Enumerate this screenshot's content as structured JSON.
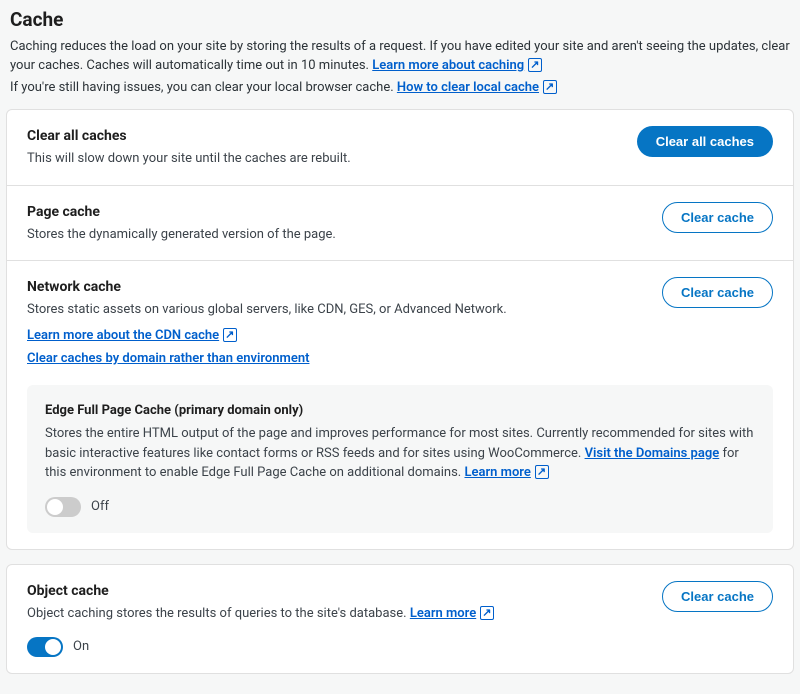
{
  "header": {
    "title": "Cache",
    "desc1": "Caching reduces the load on your site by storing the results of a request. If you have edited your site and aren't seeing the updates, clear your caches. Caches will automatically time out in 10 minutes.",
    "link1": "Learn more about caching",
    "desc2": "If you're still having issues, you can clear your local browser cache.",
    "link2": "How to clear local cache"
  },
  "clearAll": {
    "title": "Clear all caches",
    "desc": "This will slow down your site until the caches are rebuilt.",
    "button": "Clear all caches"
  },
  "pageCache": {
    "title": "Page cache",
    "desc": "Stores the dynamically generated version of the page.",
    "button": "Clear cache"
  },
  "networkCache": {
    "title": "Network cache",
    "desc": "Stores static assets on various global servers, like CDN, GES, or Advanced Network.",
    "link1": "Learn more about the CDN cache",
    "link2": "Clear caches by domain rather than environment",
    "button": "Clear cache"
  },
  "edge": {
    "title": "Edge Full Page Cache (primary domain only)",
    "desc1": "Stores the entire HTML output of the page and improves performance for most sites. Currently recommended for sites with basic interactive features like contact forms or RSS feeds and for sites using WooCommerce.",
    "link1": "Visit the Domains page",
    "desc2": "for this environment to enable Edge Full Page Cache on additional domains.",
    "link2": "Learn more",
    "toggle_state": "off",
    "toggle_label": "Off"
  },
  "objectCache": {
    "title": "Object cache",
    "desc": "Object caching stores the results of queries to the site's database.",
    "link": "Learn more",
    "button": "Clear cache",
    "toggle_state": "on",
    "toggle_label": "On"
  }
}
